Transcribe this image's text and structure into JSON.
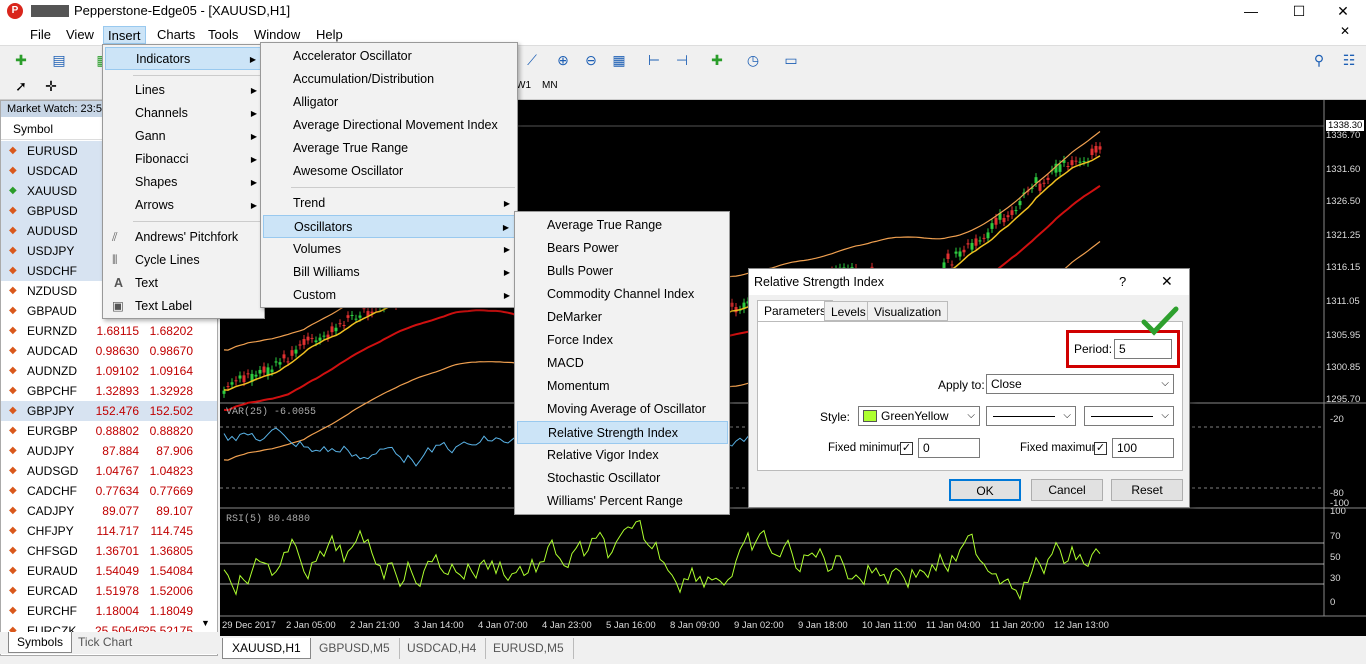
{
  "window": {
    "title": "Pepperstone-Edge05 - [XAUUSD,H1]",
    "minimize": "—",
    "maximize": "☐",
    "close": "✕"
  },
  "menubar": {
    "items": [
      "File",
      "View",
      "Insert",
      "Charts",
      "Tools",
      "Window",
      "Help"
    ]
  },
  "timeframes": [
    "W1",
    "MN"
  ],
  "market_watch": {
    "header": "Market Watch: 23:5",
    "col_symbol": "Symbol",
    "rows": [
      {
        "sym": "EURUSD",
        "bid": "",
        "ask": "",
        "dir": "down",
        "hl": true
      },
      {
        "sym": "USDCAD",
        "bid": "",
        "ask": "",
        "dir": "down",
        "hl": true
      },
      {
        "sym": "XAUUSD",
        "bid": "",
        "ask": "",
        "dir": "up",
        "hl": true
      },
      {
        "sym": "GBPUSD",
        "bid": "",
        "ask": "",
        "dir": "down",
        "hl": true
      },
      {
        "sym": "AUDUSD",
        "bid": "",
        "ask": "",
        "dir": "down",
        "hl": true
      },
      {
        "sym": "USDJPY",
        "bid": "",
        "ask": "",
        "dir": "down",
        "hl": true
      },
      {
        "sym": "USDCHF",
        "bid": "",
        "ask": "",
        "dir": "down",
        "hl": true
      },
      {
        "sym": "NZDUSD",
        "bid": "",
        "ask": "",
        "dir": "down",
        "hl": false
      },
      {
        "sym": "GBPAUD",
        "bid": "",
        "ask": "",
        "dir": "down",
        "hl": false
      },
      {
        "sym": "EURNZD",
        "bid": "1.68115",
        "ask": "1.68202",
        "dir": "down",
        "hl": false
      },
      {
        "sym": "AUDCAD",
        "bid": "0.98630",
        "ask": "0.98670",
        "dir": "down",
        "hl": false
      },
      {
        "sym": "AUDNZD",
        "bid": "1.09102",
        "ask": "1.09164",
        "dir": "down",
        "hl": false
      },
      {
        "sym": "GBPCHF",
        "bid": "1.32893",
        "ask": "1.32928",
        "dir": "down",
        "hl": false
      },
      {
        "sym": "GBPJPY",
        "bid": "152.476",
        "ask": "152.502",
        "dir": "down",
        "hl": true
      },
      {
        "sym": "EURGBP",
        "bid": "0.88802",
        "ask": "0.88820",
        "dir": "down",
        "hl": false
      },
      {
        "sym": "AUDJPY",
        "bid": "87.884",
        "ask": "87.906",
        "dir": "down",
        "hl": false
      },
      {
        "sym": "AUDSGD",
        "bid": "1.04767",
        "ask": "1.04823",
        "dir": "down",
        "hl": false
      },
      {
        "sym": "CADCHF",
        "bid": "0.77634",
        "ask": "0.77669",
        "dir": "down",
        "hl": false
      },
      {
        "sym": "CADJPY",
        "bid": "89.077",
        "ask": "89.107",
        "dir": "down",
        "hl": false
      },
      {
        "sym": "CHFJPY",
        "bid": "114.717",
        "ask": "114.745",
        "dir": "down",
        "hl": false
      },
      {
        "sym": "CHFSGD",
        "bid": "1.36701",
        "ask": "1.36805",
        "dir": "down",
        "hl": false
      },
      {
        "sym": "EURAUD",
        "bid": "1.54049",
        "ask": "1.54084",
        "dir": "down",
        "hl": false
      },
      {
        "sym": "EURCAD",
        "bid": "1.51978",
        "ask": "1.52006",
        "dir": "down",
        "hl": false
      },
      {
        "sym": "EURCHF",
        "bid": "1.18004",
        "ask": "1.18049",
        "dir": "down",
        "hl": false
      },
      {
        "sym": "EURCZK",
        "bid": "25.50545",
        "ask": "25.52175",
        "dir": "down",
        "hl": false
      }
    ],
    "tabs": [
      "Symbols",
      "Tick Chart"
    ]
  },
  "chart": {
    "price_labels": [
      "1338.30",
      "1336.70",
      "1331.60",
      "1326.50",
      "1321.25",
      "1316.15",
      "1311.05",
      "1305.95",
      "1300.85",
      "1295.70"
    ],
    "var_label": "VAR(25) -6.0055",
    "var_scale": [
      "-20",
      "-80",
      "-100"
    ],
    "rsi_label": "RSI(5) 80.4880",
    "rsi_scale": [
      "100",
      "70",
      "50",
      "30",
      "0"
    ],
    "time_labels": [
      "29 Dec 2017",
      "2 Jan 05:00",
      "2 Jan 21:00",
      "3 Jan 14:00",
      "4 Jan 07:00",
      "4 Jan 23:00",
      "5 Jan 16:00",
      "8 Jan 09:00",
      "9 Jan 02:00",
      "9 Jan 18:00",
      "10 Jan 11:00",
      "11 Jan 04:00",
      "11 Jan 20:00",
      "12 Jan 13:00"
    ],
    "tabs": [
      "XAUUSD,H1",
      "GBPUSD,M5",
      "USDCAD,H4",
      "EURUSD,M5"
    ]
  },
  "insert_menu": {
    "items": [
      "Indicators",
      "Lines",
      "Channels",
      "Gann",
      "Fibonacci",
      "Shapes",
      "Arrows",
      "Andrews' Pitchfork",
      "Cycle Lines",
      "Text",
      "Text Label"
    ]
  },
  "indicators_menu": {
    "items": [
      "Accelerator Oscillator",
      "Accumulation/Distribution",
      "Alligator",
      "Average Directional Movement Index",
      "Average True Range",
      "Awesome Oscillator",
      "Trend",
      "Oscillators",
      "Volumes",
      "Bill Williams",
      "Custom"
    ]
  },
  "oscillators_menu": {
    "items": [
      "Average True Range",
      "Bears Power",
      "Bulls Power",
      "Commodity Channel Index",
      "DeMarker",
      "Force Index",
      "MACD",
      "Momentum",
      "Moving Average of Oscillator",
      "Relative Strength Index",
      "Relative Vigor Index",
      "Stochastic Oscillator",
      "Williams' Percent Range"
    ]
  },
  "dialog": {
    "title": "Relative Strength Index",
    "help": "?",
    "close": "✕",
    "tabs": [
      "Parameters",
      "Levels",
      "Visualization"
    ],
    "period_label": "Period:",
    "period_value": "5",
    "apply_label": "Apply to:",
    "apply_value": "Close",
    "style_label": "Style:",
    "style_color_name": "GreenYellow",
    "style_color": "#adff2f",
    "fixed_min_label": "Fixed minimum",
    "fixed_min_value": "0",
    "fixed_max_label": "Fixed maximum",
    "fixed_max_value": "100",
    "ok": "OK",
    "cancel": "Cancel",
    "reset": "Reset"
  },
  "colors": {
    "highlight_box": "#d00000",
    "checkmark": "#2ea02e",
    "rsi_line": "#adff2f",
    "var_line": "#5ab4e8"
  }
}
